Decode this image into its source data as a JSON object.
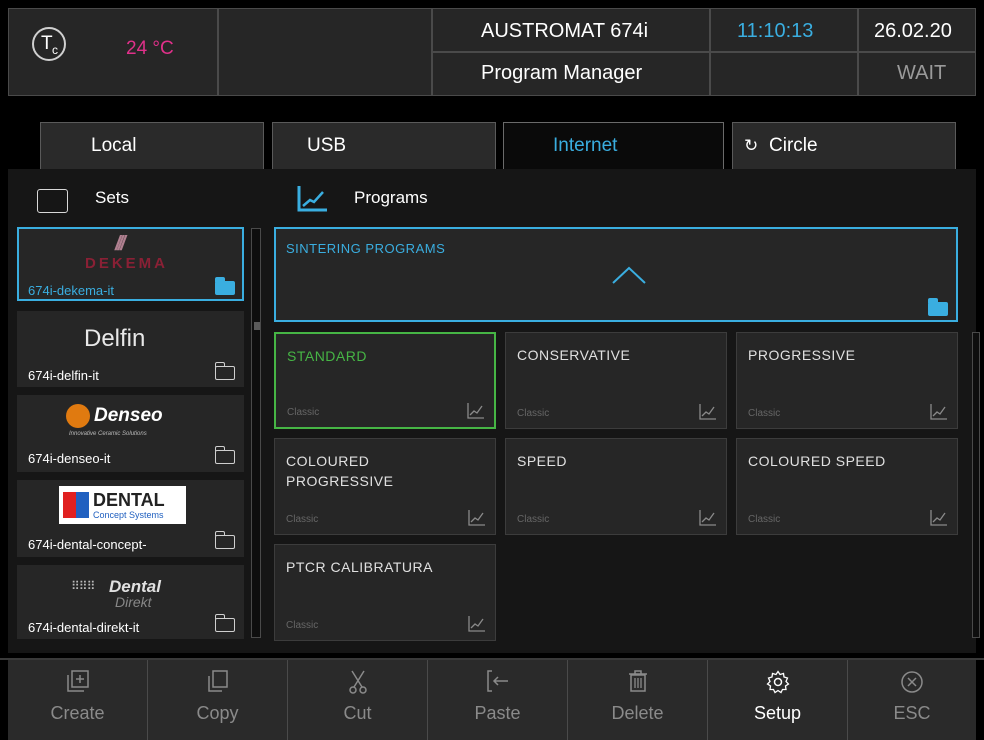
{
  "header": {
    "tc_symbol": "T",
    "tc_sub": "c",
    "temperature": "24 °C",
    "device_name": "AUSTROMAT 674i",
    "screen_title": "Program Manager",
    "time": "11:10:13",
    "date": "26.02.20",
    "status": "WAIT"
  },
  "tabs": [
    {
      "label": "Local",
      "active": false
    },
    {
      "label": "USB",
      "active": false
    },
    {
      "label": "Internet",
      "active": true
    },
    {
      "label": "Circle",
      "active": false,
      "icon": "refresh-icon"
    }
  ],
  "sections": {
    "sets_label": "Sets",
    "programs_label": "Programs"
  },
  "sets": [
    {
      "name": "674i-dekema-it",
      "logo_text": "DEKEMA",
      "selected": true
    },
    {
      "name": "674i-delfin-it",
      "logo_text": "Delfin",
      "selected": false
    },
    {
      "name": "674i-denseo-it",
      "logo_text": "Denseo",
      "logo_sub": "Innovative Ceramic Solutions",
      "selected": false
    },
    {
      "name": "674i-dental-concept-",
      "logo_text": "DENTAL",
      "logo_sub": "Concept Systems",
      "selected": false
    },
    {
      "name": "674i-dental-direkt-it",
      "logo_text": "Dental",
      "logo_sub": "Direkt",
      "selected": false
    }
  ],
  "group": {
    "title": "SINTERING PROGRAMS"
  },
  "programs": [
    {
      "name": "STANDARD",
      "type": "Classic",
      "selected": true
    },
    {
      "name": "CONSERVATIVE",
      "type": "Classic",
      "selected": false
    },
    {
      "name": "PROGRESSIVE",
      "type": "Classic",
      "selected": false
    },
    {
      "name": "COLOURED PROGRESSIVE",
      "type": "Classic",
      "selected": false
    },
    {
      "name": "SPEED",
      "type": "Classic",
      "selected": false
    },
    {
      "name": "COLOURED SPEED",
      "type": "Classic",
      "selected": false
    },
    {
      "name": "PTCR CALIBRATURA",
      "type": "Classic",
      "selected": false
    }
  ],
  "toolbar": [
    {
      "label": "Create",
      "icon": "create-icon",
      "enabled": false
    },
    {
      "label": "Copy",
      "icon": "copy-icon",
      "enabled": false
    },
    {
      "label": "Cut",
      "icon": "cut-icon",
      "enabled": false
    },
    {
      "label": "Paste",
      "icon": "paste-icon",
      "enabled": false
    },
    {
      "label": "Delete",
      "icon": "delete-icon",
      "enabled": false
    },
    {
      "label": "Setup",
      "icon": "gear-icon",
      "enabled": true
    },
    {
      "label": "ESC",
      "icon": "close-icon",
      "enabled": false
    }
  ],
  "colors": {
    "accent_blue": "#3aaee0",
    "selected_green": "#46b545",
    "temperature_pink": "#e0308a"
  }
}
